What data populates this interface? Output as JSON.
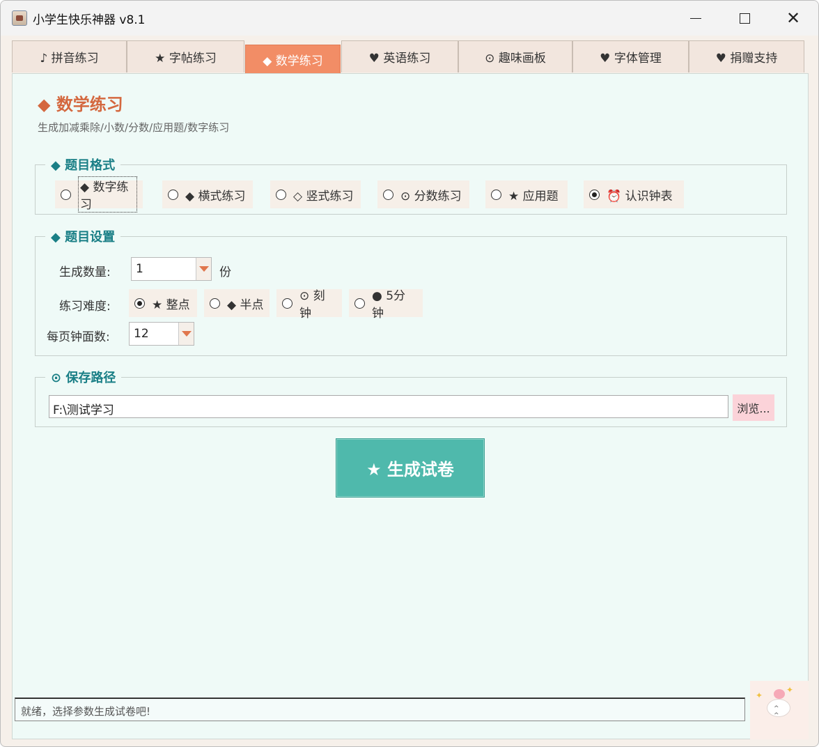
{
  "window": {
    "title": "小学生快乐神器 v8.1"
  },
  "tabs": [
    {
      "label": "♪ 拼音练习"
    },
    {
      "label": "★ 字帖练习"
    },
    {
      "label": "◆ 数学练习"
    },
    {
      "label": "♥ 英语练习"
    },
    {
      "label": "⊙ 趣味画板"
    },
    {
      "label": "♥ 字体管理"
    },
    {
      "label": "♥ 捐赠支持"
    }
  ],
  "active_tab": "◆ 数学练习",
  "header": {
    "title": "◆ 数学练习",
    "subtitle": "生成加减乘除/小数/分数/应用题/数字练习"
  },
  "format_group": {
    "title": "◆ 题目格式",
    "options": [
      {
        "label": "◆ 数字练习",
        "selected": false
      },
      {
        "label": "◆ 横式练习",
        "selected": false
      },
      {
        "label": "◇ 竖式练习",
        "selected": false
      },
      {
        "label": "⊙ 分数练习",
        "selected": false
      },
      {
        "label": "★ 应用题",
        "selected": false
      },
      {
        "label": "⏰ 认识钟表",
        "selected": true
      }
    ]
  },
  "settings_group": {
    "title": "◆ 题目设置",
    "count_label": "生成数量:",
    "count_value": "1",
    "count_unit": "份",
    "difficulty_label": "练习难度:",
    "difficulty_options": [
      {
        "label": "★ 整点",
        "selected": true
      },
      {
        "label": "◆ 半点",
        "selected": false
      },
      {
        "label": "⊙ 刻钟",
        "selected": false
      },
      {
        "label": "● 5分钟",
        "selected": false
      }
    ],
    "per_page_label": "每页钟面数:",
    "per_page_value": "12"
  },
  "save_group": {
    "title": "⊙ 保存路径",
    "path": "F:\\测试学习",
    "browse_label": "浏览..."
  },
  "generate_button": "★ 生成试卷",
  "status_text": "就绪，选择参数生成试卷吧!",
  "colors": {
    "accent_orange": "#f28d66",
    "teal_title": "#1a7f86",
    "generate_button": "#4fb9ac",
    "panel_bg": "#effaf7",
    "browse_bg": "#fbd3d9"
  }
}
